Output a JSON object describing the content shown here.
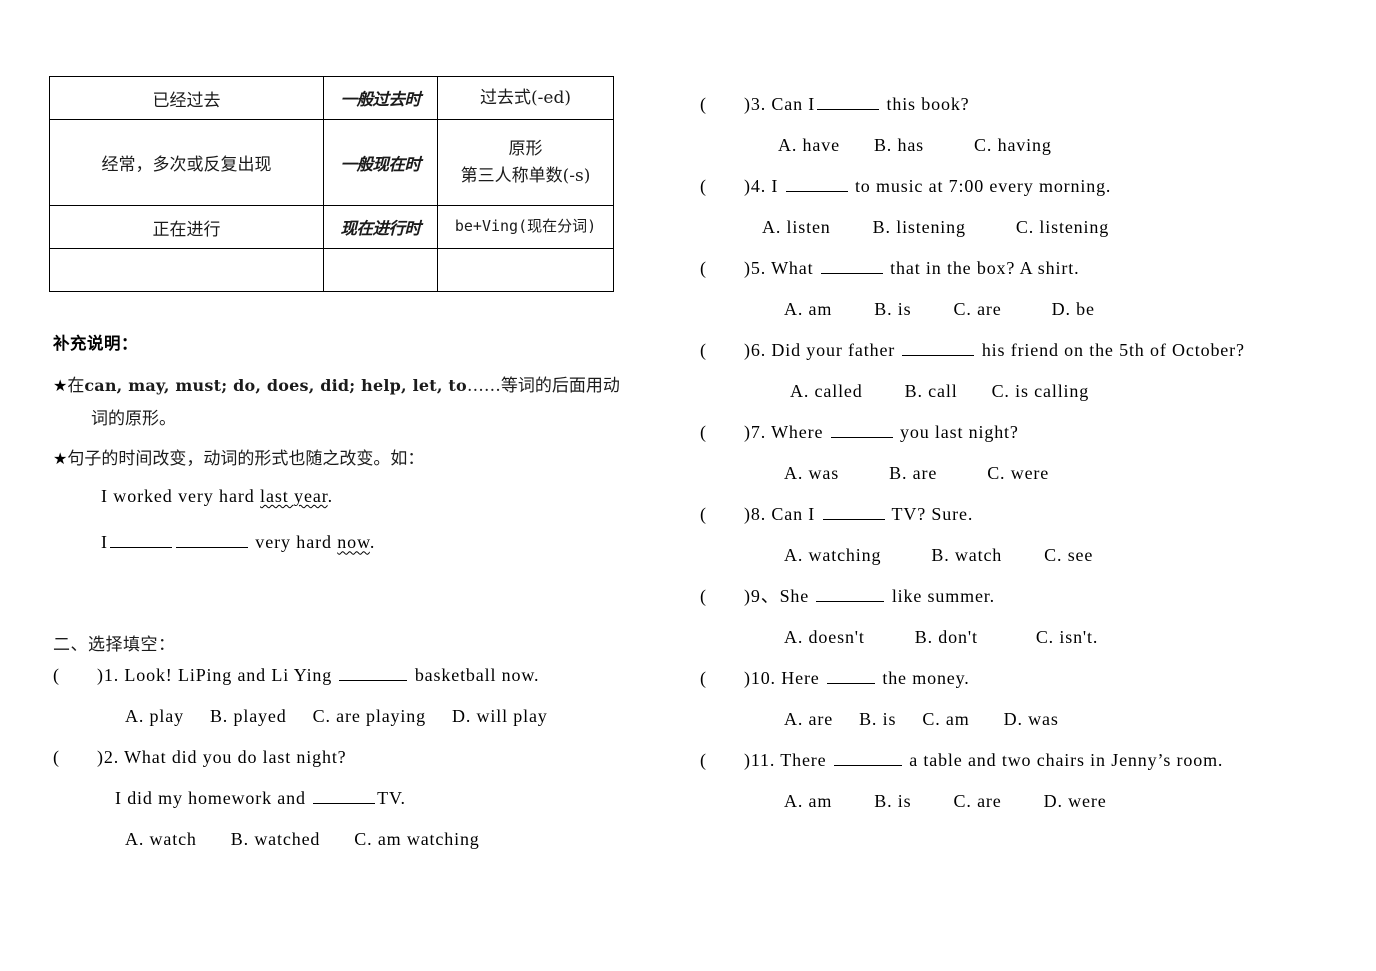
{
  "table": {
    "rows": [
      {
        "description": "已经过去",
        "tense": "一般过去时",
        "form_lines": [
          "过去式(-ed)"
        ],
        "form_mono": false
      },
      {
        "description": "经常，多次或反复出现",
        "tense": "一般现在时",
        "form_lines": [
          "原形",
          "第三人称单数(-s)"
        ],
        "form_mono": false
      },
      {
        "description": "正在进行",
        "tense": "现在进行时",
        "form_lines": [
          "be+Ving(现在分词)"
        ],
        "form_mono": true
      },
      {
        "description": "",
        "tense": "",
        "form_lines": [
          ""
        ],
        "form_mono": false
      }
    ]
  },
  "supplement": {
    "title": "补充说明：",
    "star_glyph": "★",
    "bullet1": {
      "prefix_cn": "在",
      "english": "can, may, must; do, does, did; help, let, to",
      "ellipsis": "……",
      "suffix_cn": "等词的后面用动",
      "continuation": "词的原形。"
    },
    "bullet2": {
      "text": "句子的时间改变，动词的形式也随之改变。如："
    },
    "example1": {
      "before": "I worked very hard ",
      "wavy": "last year",
      "after": "."
    },
    "example2": {
      "pronoun": "I",
      "after_blanks": " very hard ",
      "wavy": "now",
      "end": "."
    }
  },
  "section_two": {
    "heading": "二、选择填空：",
    "questions": [
      {
        "paren_open": "(",
        "paren_close": ")",
        "number": "1.",
        "stem_before": " Look! LiPing and Li Ying ",
        "stem_after": " basketball now.",
        "options": [
          "A. play",
          "B. played",
          "C. are playing",
          "D. will play"
        ]
      },
      {
        "paren_open": "(",
        "paren_close": ")",
        "number": "2.",
        "stem_before": " What did you do last night?",
        "stem_after": "",
        "sub_before": "I did my homework and ",
        "sub_after": "TV.",
        "options": [
          "A. watch",
          "B. watched",
          "C. am watching"
        ]
      }
    ]
  },
  "right_column": {
    "questions": [
      {
        "paren_open": "(",
        "paren_close": ")",
        "number": "3.",
        "stem_before": " Can I",
        "stem_after": " this book?",
        "options": [
          "A. have",
          "B. has",
          "C. having"
        ]
      },
      {
        "paren_open": "(",
        "paren_close": ")",
        "number": "4.",
        "stem_before": " I ",
        "stem_after": " to music at 7:00 every morning.",
        "options": [
          "A. listen",
          "B. listening",
          "C. listening"
        ]
      },
      {
        "paren_open": "(",
        "paren_close": ")",
        "number": "5.",
        "stem_before": " What ",
        "stem_after": " that in the box?    A shirt.",
        "options": [
          "A. am",
          "B. is",
          "C. are",
          "D. be"
        ]
      },
      {
        "paren_open": "(",
        "paren_close": ")",
        "number": "6.",
        "stem_before": " Did your father ",
        "stem_after": " his friend on the 5th of October?",
        "options": [
          "A. called",
          "B. call",
          "C. is calling"
        ]
      },
      {
        "paren_open": "(",
        "paren_close": ")",
        "number": "7.",
        "stem_before": " Where ",
        "stem_after": " you last night?",
        "options": [
          "A. was",
          "B. are",
          "C. were"
        ]
      },
      {
        "paren_open": "(",
        "paren_close": ")",
        "number": "8.",
        "stem_before": " Can I ",
        "stem_after": " TV?    Sure.",
        "options": [
          "A. watching",
          "B. watch",
          "C. see"
        ]
      },
      {
        "paren_open": "(",
        "paren_close": ")",
        "number": "9、",
        "stem_before": "She ",
        "stem_after": " like summer.",
        "options": [
          "A. doesn't",
          "B. don't",
          "C. isn't."
        ]
      },
      {
        "paren_open": "(",
        "paren_close": ")",
        "number": "10.",
        "stem_before": " Here ",
        "stem_after": " the money.",
        "options": [
          "A. are",
          "B. is",
          "C. am",
          "D. was"
        ]
      },
      {
        "paren_open": "(",
        "paren_close": ")",
        "number": "11.",
        "stem_before": " There ",
        "stem_after": " a table and two chairs in Jenny’s room.",
        "options": [
          "A. am",
          "B. is",
          "C. are",
          "D. were"
        ]
      }
    ]
  }
}
